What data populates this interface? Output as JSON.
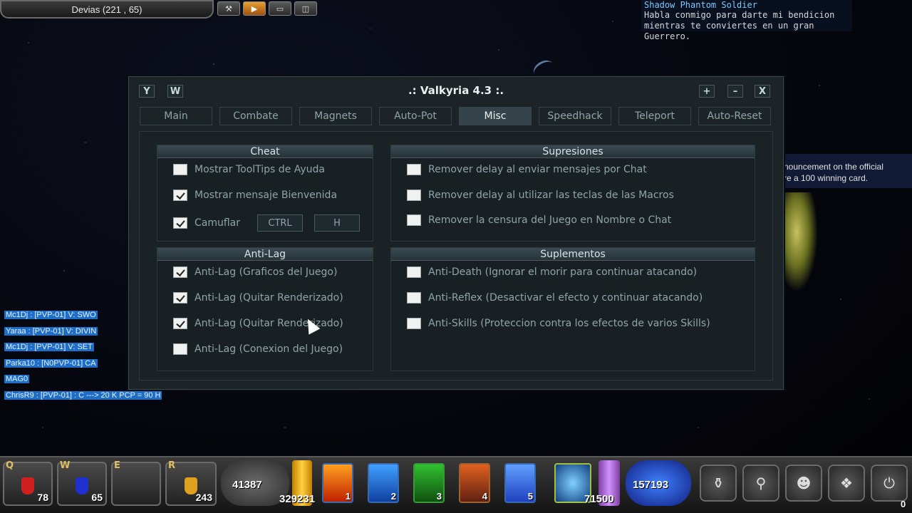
{
  "location": {
    "text": "Devias (221 , 65)"
  },
  "top_buttons": [
    {
      "icon": "wrench-icon",
      "glyph": "⚒"
    },
    {
      "icon": "play-icon",
      "glyph": "▶"
    },
    {
      "icon": "camera-icon",
      "glyph": "▭"
    },
    {
      "icon": "options-icon",
      "glyph": "◫"
    }
  ],
  "npc": {
    "name": "Shadow Phantom Soldier",
    "line1": "Habla conmigo para darte mi bendicion",
    "line2": "mientras te conviertes en un gran Guerrero."
  },
  "announcement": {
    "line1": "nouncement on the official",
    "line2": "re a 100 winning card."
  },
  "chat": [
    "Mc1Dj : [PVP-01] V: SWO",
    "Yaraa : [PVP-01] V: DIVIN",
    "Mc1Dj : [PVP-01] V: SET",
    "Parka10 : [N0PVP-01] CA",
    "MAG0",
    "ChrisR9 : [PVP-01] : C ---> 20 K PCP = 90 H"
  ],
  "window": {
    "title": ".: Valkyria 4.3 :.",
    "left_buttons": [
      "Y",
      "W"
    ],
    "right_buttons": [
      "+",
      "–",
      "X"
    ],
    "tabs": [
      "Main",
      "Combate",
      "Magnets",
      "Auto-Pot",
      "Misc",
      "Speedhack",
      "Teleport",
      "Auto-Reset"
    ],
    "active_tab": "Misc",
    "cheat": {
      "title": "Cheat",
      "options": [
        {
          "label": "Mostrar ToolTips de Ayuda",
          "checked": false
        },
        {
          "label": "Mostrar mensaje Bienvenida",
          "checked": true
        },
        {
          "label": "Camuflar",
          "checked": true
        }
      ],
      "key1": "CTRL",
      "key2": "H"
    },
    "supresiones": {
      "title": "Supresiones",
      "options": [
        {
          "label": "Remover delay al enviar mensajes por Chat",
          "checked": false
        },
        {
          "label": "Remover delay al utilizar las teclas de las Macros",
          "checked": false
        },
        {
          "label": "Remover la censura del Juego en Nombre o Chat",
          "checked": false
        }
      ]
    },
    "antilag": {
      "title": "Anti-Lag",
      "options": [
        {
          "label": "Anti-Lag (Graficos del Juego)",
          "checked": true
        },
        {
          "label": "Anti-Lag (Quitar Renderizado)",
          "checked": true
        },
        {
          "label": "Anti-Lag (Quitar Renderizado)",
          "checked": true
        },
        {
          "label": "Anti-Lag (Conexion del Juego)",
          "checked": false
        }
      ]
    },
    "suplementos": {
      "title": "Suplementos",
      "options": [
        {
          "label": "Anti-Death (Ignorar el morir para continuar atacando)",
          "checked": false
        },
        {
          "label": "Anti-Reflex (Desactivar el efecto y continuar atacando)",
          "checked": false
        },
        {
          "label": "Anti-Skills (Proteccion contra los efectos de varios Skills)",
          "checked": false
        }
      ]
    }
  },
  "hotbar": {
    "slots": [
      {
        "key": "Q",
        "count": "78",
        "color": "#d02020"
      },
      {
        "key": "W",
        "count": "65",
        "color": "#2030d0"
      },
      {
        "key": "E",
        "count": "",
        "color": ""
      },
      {
        "key": "R",
        "count": "243",
        "color": "#e0a020"
      }
    ],
    "hp": "41387",
    "exp": "329231",
    "mana": "71500",
    "ag": "157193",
    "skills": [
      "1",
      "2",
      "3",
      "4",
      "5"
    ],
    "zen": "0",
    "system_icons": [
      "bag-icon",
      "search-icon",
      "party-icon",
      "guild-icon",
      "power-icon"
    ]
  }
}
